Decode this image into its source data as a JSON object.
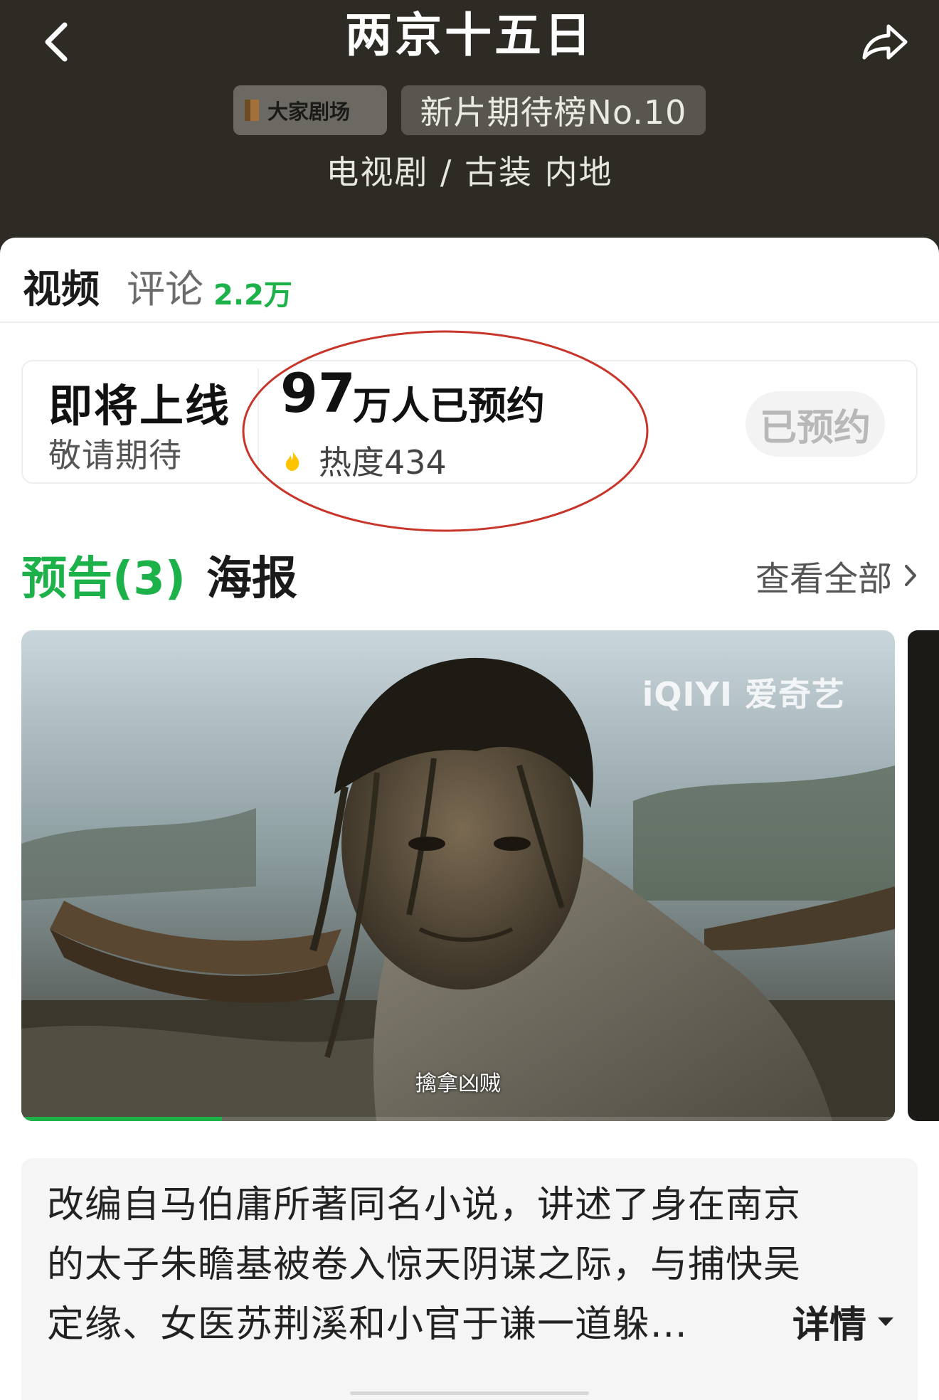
{
  "header": {
    "title": "两京十五日",
    "brand_tag": "大家剧场",
    "rank_tag": "新片期待榜No.10",
    "genre": "电视剧 / 古装 内地",
    "background_color": "#2d2b24",
    "back_icon": "chevron-left-icon",
    "share_icon": "share-arrow-icon"
  },
  "tabs": {
    "video": "视频",
    "comments": "评论",
    "comment_count": "2.2万"
  },
  "reservation": {
    "status_title": "即将上线",
    "status_sub": "敬请期待",
    "count_number": "97",
    "count_text": "万人已预约",
    "heat_label": "热度434",
    "reserved_button": "已预约"
  },
  "section": {
    "trailer_tab": "预告(3)",
    "poster_tab": "海报",
    "see_all": "查看全部"
  },
  "video": {
    "watermark": "iQIYI 爱奇艺",
    "subtitle": "擒拿凶贼",
    "progress": 0.23
  },
  "synopsis": {
    "lines": [
      "改编自马伯庸所著同名小说，讲述了身在南京",
      "的太子朱瞻基被卷入惊天阴谋之际，与捕快吴",
      "定缘、女医苏荆溪和小官于谦一道躲..."
    ],
    "details": "详情"
  },
  "colors": {
    "accent_green": "#1db14a",
    "highlight_red": "#c8352b"
  }
}
